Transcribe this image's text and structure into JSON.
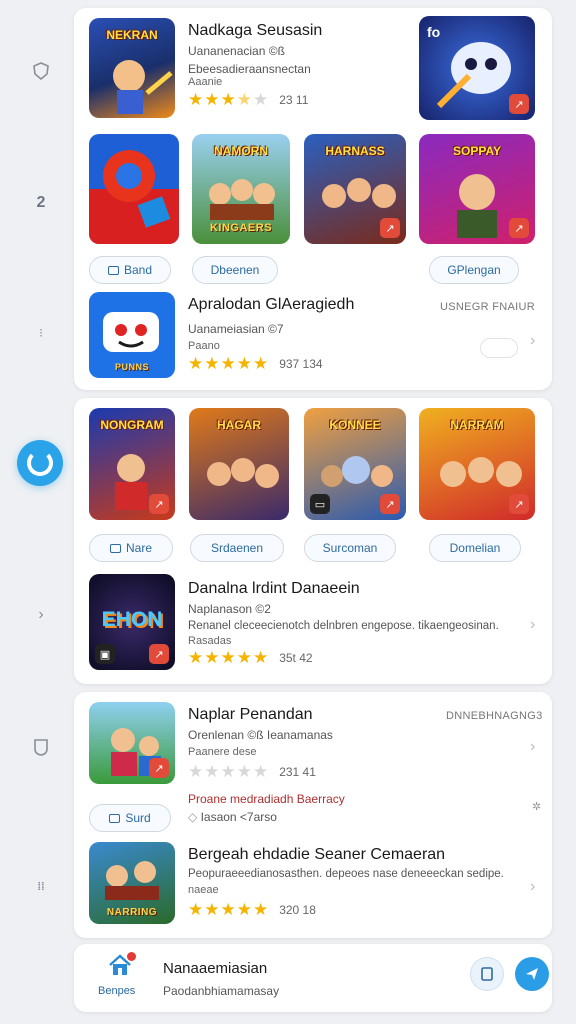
{
  "colors": {
    "accent": "#2aa3e8",
    "star": "#f5b400",
    "badge": "#e24a3a"
  },
  "rail": {
    "icons": [
      "shield-icon",
      "number-icon",
      "dot-icon",
      "active-circle-icon",
      "chevron-right-icon",
      "shield-outline-icon",
      "pause-icon"
    ]
  },
  "featured": {
    "title": "Nadkaga Seusasin",
    "sub1": "Uananenacian ©ß",
    "sub2": "Ebeesadieraansnectan",
    "sub3": "Aaanie",
    "rating_value": 3.5,
    "rating_count": "23  11",
    "thumb_caption": "NEKRAN",
    "art_tag": "fo"
  },
  "row1": {
    "thumbs": [
      {
        "caption": "",
        "icon": "game-tile"
      },
      {
        "caption": "NAMORN",
        "overlay": "KINGAERS"
      },
      {
        "caption": "HARNASS",
        "overlay": ""
      },
      {
        "caption": "SOPPAY",
        "overlay": ""
      }
    ],
    "pills": [
      "Band",
      "Dbeenen",
      "GPlengan"
    ]
  },
  "app2": {
    "title": "Apralodan GlAeragiedh",
    "meta": "USNEGR FNAIUR",
    "sub1": "Uanameiasian ©7",
    "sub2": "Paano",
    "rating_value": 5,
    "rating_count": "937  134",
    "icon_caption": "PUNNS"
  },
  "row2": {
    "thumbs": [
      {
        "caption": "NONGRAM",
        "overlay": ""
      },
      {
        "caption": "HAGAR",
        "overlay": ""
      },
      {
        "caption": "KONNEE",
        "overlay": ""
      },
      {
        "caption": "NARRAM",
        "overlay": ""
      }
    ],
    "pills": [
      "Nare",
      "Srdaenen",
      "Surcoman",
      "Domelian"
    ]
  },
  "app3": {
    "title": "Danalna lrdint Danaeein",
    "sub1": "Naplanason ©2",
    "sub2": "Renanel cleceecienotch delnbren engepose. tikaengeosinan.",
    "sub3": "Rasadas",
    "rating_value": 5,
    "rating_count": "35t  42",
    "icon_caption": "EHON"
  },
  "app4": {
    "title": "Naplar Penandan",
    "meta": "DNNEBHNAGNG3",
    "sub1": "Orenlenan ©ß  Ieanamanas",
    "sub2": "Paanere dese",
    "rating_value": 0,
    "rating_count": "231  41",
    "promo": "Proane medradiadh Baerracy",
    "promo2": "Iasaon <7arso",
    "pill": "Surd"
  },
  "app5": {
    "title": "Bergeah ehdadie Seaner Cemaeran",
    "sub1": "Peopuraeeedianosasthen. depeoes nase deneeeckan sedipe.",
    "sub2": "naeae",
    "rating_value": 5,
    "rating_count": "320  18",
    "icon_caption": "NARRING"
  },
  "bottom_bar": {
    "title": "Nanaaemiasian",
    "subtitle": "Paodanbhiamamasay",
    "home_label": "Benpes"
  }
}
